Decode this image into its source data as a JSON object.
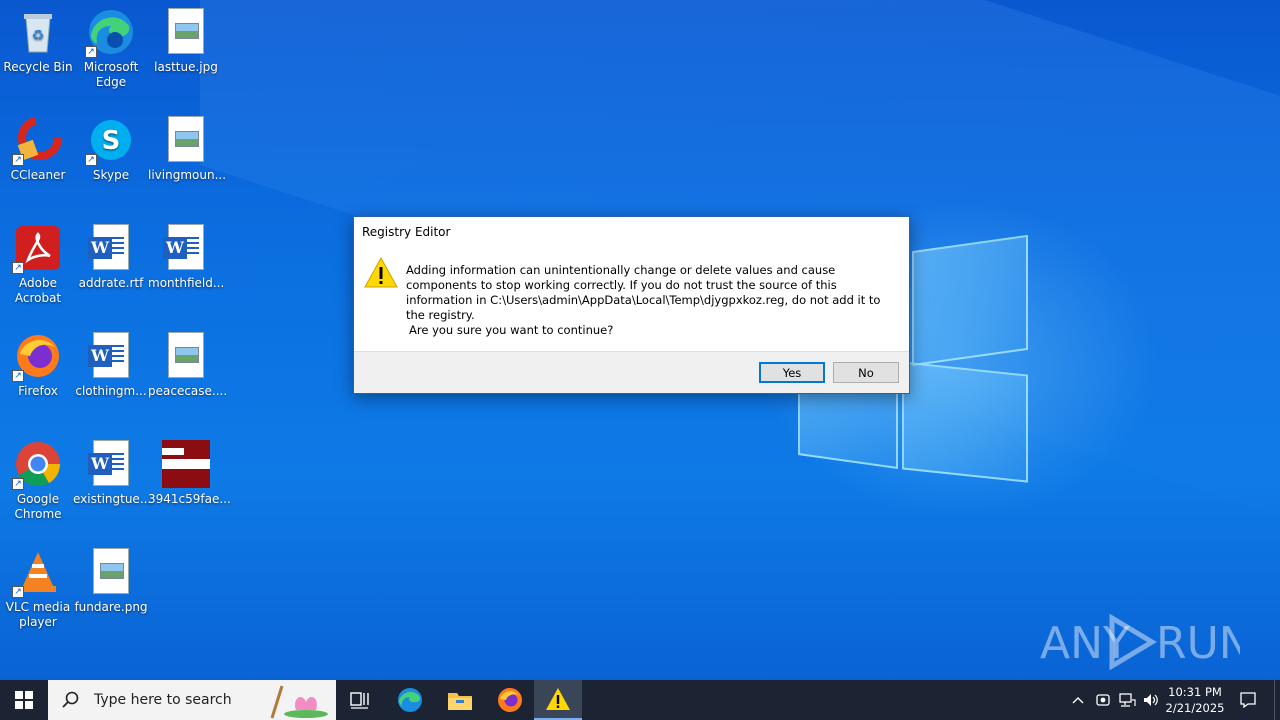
{
  "desktop_icons": [
    {
      "label": "Recycle Bin"
    },
    {
      "label": "Microsoft Edge"
    },
    {
      "label": "lasttue.jpg"
    },
    {
      "label": "CCleaner"
    },
    {
      "label": "Skype"
    },
    {
      "label": "livingmoun..."
    },
    {
      "label": "Adobe Acrobat"
    },
    {
      "label": "addrate.rtf"
    },
    {
      "label": "monthfield..."
    },
    {
      "label": "Firefox"
    },
    {
      "label": "clothingm..."
    },
    {
      "label": "peacecase...."
    },
    {
      "label": "Google Chrome"
    },
    {
      "label": "existingtue..."
    },
    {
      "label": "3941c59fae..."
    },
    {
      "label": "VLC media player"
    },
    {
      "label": "fundare.png"
    }
  ],
  "dialog": {
    "title": "Registry Editor",
    "message": "Adding information can unintentionally change or delete values and cause components to stop working correctly. If you do not trust the source of this information in C:\\Users\\admin\\AppData\\Local\\Temp\\djygpxkoz.reg, do not add it to the registry.",
    "question": "Are you sure you want to continue?",
    "yes_label": "Yes",
    "no_label": "No"
  },
  "taskbar": {
    "search_placeholder": "Type here to search",
    "time": "10:31 PM",
    "date": "2/21/2025"
  },
  "watermark": "ANY RUN",
  "colors": {
    "taskbar_bg": "#1c2433",
    "desktop_blue": "#0b6ee0",
    "accent": "#0078d7"
  }
}
